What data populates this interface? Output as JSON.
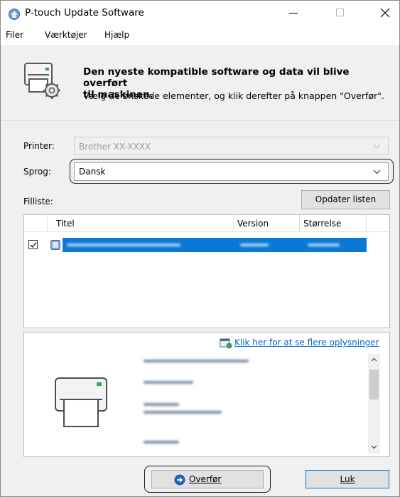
{
  "window": {
    "title": "P-touch Update Software",
    "title_icon": "ptouch-app-icon",
    "controls": [
      "minimize",
      "maximize",
      "close"
    ]
  },
  "menu": [
    {
      "label": "Filer"
    },
    {
      "label": "Værktøjer"
    },
    {
      "label": "Hjælp"
    }
  ],
  "header": {
    "headline": "Den nyeste kompatible software og data vil blive overført til maskinen.",
    "headline_line1": "Den nyeste kompatible software og data vil blive overført",
    "headline_line2": "til maskinen.",
    "instruction": "Vælg de ønskede elementer, og klik derefter på knappen \"Overfør\"."
  },
  "form": {
    "printer_label": "Printer:",
    "printer_value": "Brother XX-XXXX",
    "language_label": "Sprog:",
    "language_value": "Dansk",
    "filelist_label": "Filliste:",
    "refresh_button": "Opdater listen"
  },
  "file_table": {
    "columns": [
      "Titel",
      "Version",
      "Størrelse"
    ],
    "rows": [
      {
        "checked": true,
        "selected": true
      }
    ]
  },
  "details": {
    "more_info_link": "Klik her for at se flere oplysninger"
  },
  "buttons": {
    "transfer": "Overfør",
    "close": "Luk"
  },
  "colors": {
    "selection": "#0a78d7",
    "link": "#0066cc",
    "highlight_border": "#1a1a1a"
  }
}
